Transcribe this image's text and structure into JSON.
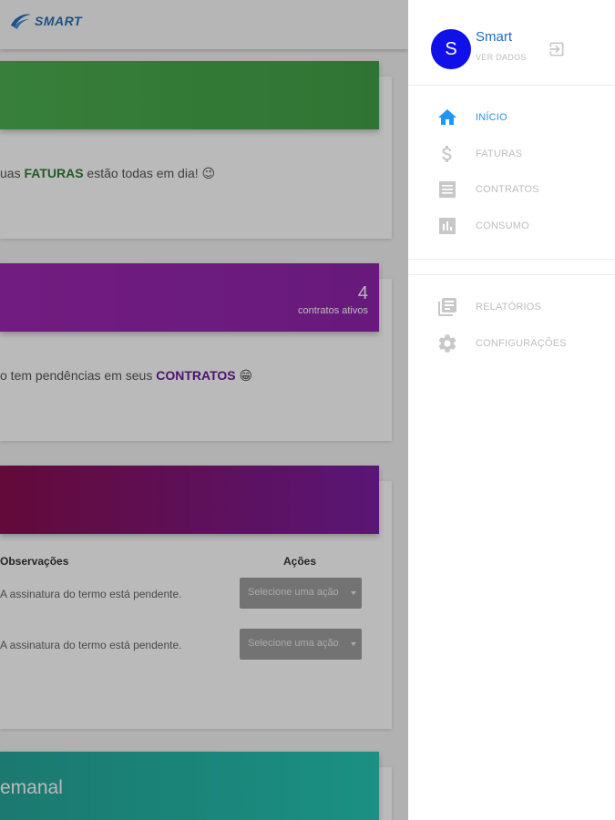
{
  "brand": {
    "logo_text": "SMART"
  },
  "cards": {
    "faturas": {
      "text_before": "uas ",
      "highlight": "FATURAS",
      "text_after": " estão todas em dia! 😉",
      "highlight_color": "#2e7d32"
    },
    "contratos": {
      "count": "4",
      "count_label": "contratos ativos",
      "text_before": "o tem pendências em seus ",
      "highlight": "CONTRATOS",
      "text_after": " 😁",
      "highlight_color": "#6a1b9a"
    },
    "pendencias": {
      "col_observacoes": "Observações",
      "col_acoes": "Ações",
      "rows": [
        {
          "observacao": "A assinatura do termo está pendente.",
          "acao_placeholder": "Selecione uma ação"
        },
        {
          "observacao": "A assinatura do termo está pendente.",
          "acao_placeholder": "Selecione uma ação"
        }
      ]
    },
    "semanal": {
      "title": "emanal"
    }
  },
  "drawer": {
    "avatar_letter": "S",
    "user_name": "Smart",
    "user_subtitle": "VER DADOS",
    "nav": [
      {
        "label": "INÍCIO",
        "icon": "home-icon",
        "active": true
      },
      {
        "label": "FATURAS",
        "icon": "dollar-icon",
        "active": false
      },
      {
        "label": "CONTRATOS",
        "icon": "document-icon",
        "active": false
      },
      {
        "label": "CONSUMO",
        "icon": "bar-chart-icon",
        "active": false
      }
    ],
    "nav_secondary": [
      {
        "label": "RELATÓRIOS",
        "icon": "library-books-icon"
      },
      {
        "label": "CONFIGURAÇÕES",
        "icon": "gear-icon"
      }
    ]
  },
  "colors": {
    "active": "#2196f3",
    "inactive": "#bdbdbd",
    "avatar": "#1010e8",
    "card_green": "#4caf50",
    "card_purple": "#9c27b0",
    "card_dark_purple": "#880e4f",
    "card_teal": "#26a69a"
  }
}
